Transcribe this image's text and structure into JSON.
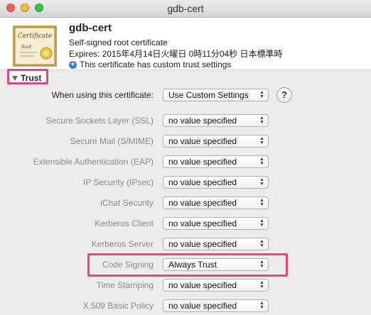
{
  "window": {
    "title": "gdb-cert"
  },
  "certificate": {
    "name": "gdb-cert",
    "type": "Self-signed root certificate",
    "expires": "Expires: 2015年4月14日火曜日 0時11分04秒 日本標準時",
    "note": "This certificate has custom trust settings",
    "image_text_1": "Certificate",
    "image_text_2": "Root"
  },
  "trust": {
    "section_label": "Trust",
    "when_using_label": "When using this certificate:",
    "when_using_value": "Use Custom Settings",
    "help": "?",
    "rows": [
      {
        "label": "Secure Sockets Layer (SSL)",
        "value": "no value specified"
      },
      {
        "label": "Secure Mail (S/MIME)",
        "value": "no value specified"
      },
      {
        "label": "Extensible Authentication (EAP)",
        "value": "no value specified"
      },
      {
        "label": "IP Security (IPsec)",
        "value": "no value specified"
      },
      {
        "label": "iChat Security",
        "value": "no value specified"
      },
      {
        "label": "Kerberos Client",
        "value": "no value specified"
      },
      {
        "label": "Kerberos Server",
        "value": "no value specified"
      },
      {
        "label": "Code Signing",
        "value": "Always Trust"
      },
      {
        "label": "Time Stamping",
        "value": "no value specified"
      },
      {
        "label": "X.509 Basic Policy",
        "value": "no value specified"
      }
    ]
  },
  "colors": {
    "highlight": "#f0417f",
    "info_icon": "#2d7de3"
  }
}
